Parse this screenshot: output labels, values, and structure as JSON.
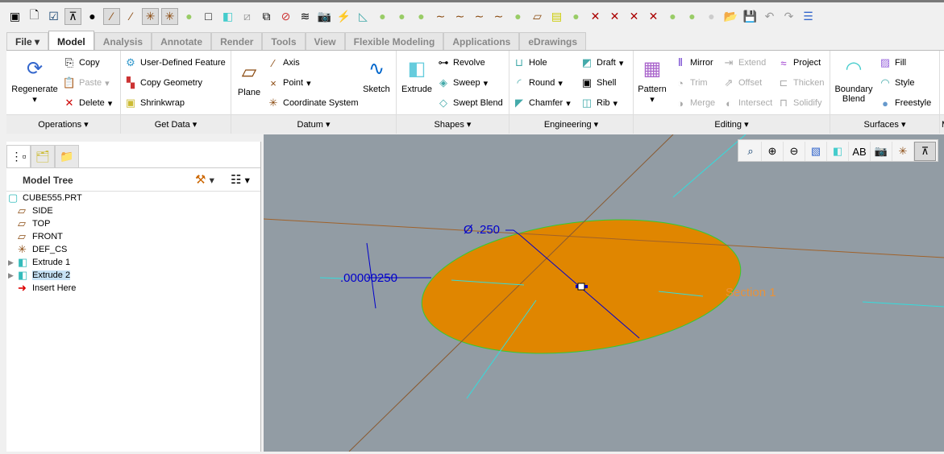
{
  "quick_access_icons": [
    "repaint",
    "new",
    "select-check",
    "datum-display",
    "sphere-shade",
    "axis-display",
    "axis-display-2",
    "csys-display",
    "csys-display-2",
    "ball",
    "plane-view",
    "cube",
    "hidden-line",
    "wireframe",
    "no-hidden",
    "layers-copy",
    "layers",
    "screenshot",
    "lightning",
    "triangle",
    "ball",
    "ball",
    "ball",
    "curve",
    "curve",
    "curve",
    "curve",
    "ball",
    "plane",
    "analysis",
    "ball",
    "x-mark",
    "x-mark",
    "x-mark",
    "x-mark",
    "ball",
    "ball",
    "ball",
    "open",
    "save",
    "undo",
    "redo",
    "regenerate"
  ],
  "tabs": [
    {
      "label": "File ▾"
    },
    {
      "label": "Model"
    },
    {
      "label": "Analysis"
    },
    {
      "label": "Annotate"
    },
    {
      "label": "Render"
    },
    {
      "label": "Tools"
    },
    {
      "label": "View"
    },
    {
      "label": "Flexible Modeling"
    },
    {
      "label": "Applications"
    },
    {
      "label": "eDrawings"
    }
  ],
  "ribbon": {
    "operations": {
      "label": "Operations ▾",
      "regenerate": "Regenerate",
      "copy": "Copy",
      "paste": "Paste",
      "delete": "Delete"
    },
    "get_data": {
      "label": "Get Data ▾",
      "udf": "User-Defined Feature",
      "copy_geometry": "Copy Geometry",
      "shrinkwrap": "Shrinkwrap"
    },
    "datum": {
      "label": "Datum ▾",
      "plane": "Plane",
      "axis": "Axis",
      "point": "Point",
      "csys": "Coordinate System",
      "sketch": "Sketch"
    },
    "shapes": {
      "label": "Shapes ▾",
      "extrude": "Extrude",
      "revolve": "Revolve",
      "sweep": "Sweep",
      "swept_blend": "Swept Blend"
    },
    "engineering": {
      "label": "Engineering ▾",
      "hole": "Hole",
      "round": "Round",
      "chamfer": "Chamfer",
      "draft": "Draft",
      "shell": "Shell",
      "rib": "Rib"
    },
    "editing": {
      "label": "Editing ▾",
      "pattern": "Pattern",
      "mirror": "Mirror",
      "trim": "Trim",
      "merge": "Merge",
      "extend": "Extend",
      "offset": "Offset",
      "intersect": "Intersect",
      "project": "Project",
      "thicken": "Thicken",
      "solidify": "Solidify"
    },
    "surfaces": {
      "label": "Surfaces ▾",
      "boundary_blend": "Boundary Blend",
      "fill": "Fill",
      "style": "Style",
      "freestyle": "Freestyle"
    },
    "more": "M"
  },
  "model_tree": {
    "title": "Model Tree",
    "items": [
      {
        "label": "CUBE555.PRT",
        "icon": "part"
      },
      {
        "label": "SIDE",
        "icon": "plane"
      },
      {
        "label": "TOP",
        "icon": "plane"
      },
      {
        "label": "FRONT",
        "icon": "plane"
      },
      {
        "label": "DEF_CS",
        "icon": "csys"
      },
      {
        "label": "Extrude 1",
        "icon": "extrude"
      },
      {
        "label": "Extrude 2",
        "icon": "extrude",
        "selected": true
      },
      {
        "label": "Insert Here",
        "icon": "arrow"
      }
    ]
  },
  "viewport": {
    "diameter_dim": "Ø .250",
    "depth_dim": ".00000250",
    "section_label": "Section 1",
    "section_color": "#e08600",
    "bg_color": "#929ca4"
  },
  "view_toolbar": [
    "refit",
    "zoom-in",
    "zoom-out",
    "repaint",
    "saved-orientations",
    "named-views",
    "display-style",
    "datum-display",
    "annotation-display"
  ]
}
